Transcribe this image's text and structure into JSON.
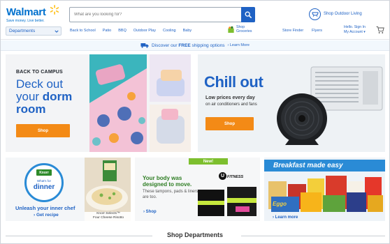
{
  "colors": {
    "brand_blue": "#1f62c4",
    "spark_yellow": "#ffc220",
    "shop_orange": "#f38a16",
    "new_green": "#7dbf2e"
  },
  "header": {
    "logo": "Walmart",
    "tagline": "Save money. Live better.",
    "search_placeholder": "What are you looking for?",
    "search_icon": "search-icon",
    "outdoor_link": "Shop Outdoor Living",
    "departments": "Departments",
    "nav": [
      "Back to School",
      "Patio",
      "BBQ",
      "Outdoor Play",
      "Cooling",
      "Baby"
    ],
    "groceries_line1": "Shop",
    "groceries_line2": "Groceries",
    "store_finder": "Store Finder",
    "flyers": "Flyers",
    "account_line1": "Hello. Sign In",
    "account_line2": "My Account"
  },
  "shipping": {
    "text_prefix": "Discover our ",
    "text_bold": "FREE",
    "text_suffix": " shipping options",
    "more": "Learn More"
  },
  "dorm": {
    "pre": "BACK TO CAMPUS",
    "line1": "Deck out",
    "line2": "your ",
    "line2_bold": "dorm",
    "line3": "room",
    "button": "Shop"
  },
  "chill": {
    "title": "Chill out",
    "sub": "Low prices every day",
    "sub2": "on air conditioners and fans",
    "button": "Shop"
  },
  "knorr": {
    "brand": "Knorr",
    "circle_line1": "What's for",
    "circle_line2": "dinner",
    "headline": "Unleash your inner chef",
    "link": "Get recipe",
    "caption_line1": "Knorr Selects™",
    "caption_line2": "Four Cheese Risotto"
  },
  "ufit": {
    "badge": "New!",
    "headline": "Your body was designed to move.",
    "sub": "These tampons, pads & liners are too.",
    "link": "Shop",
    "brand": "FITNESS"
  },
  "breakfast": {
    "headline": "Breakfast made easy",
    "link": "Learn more",
    "box_label": "Eggo"
  },
  "footer": {
    "section_title": "Shop Departments"
  }
}
